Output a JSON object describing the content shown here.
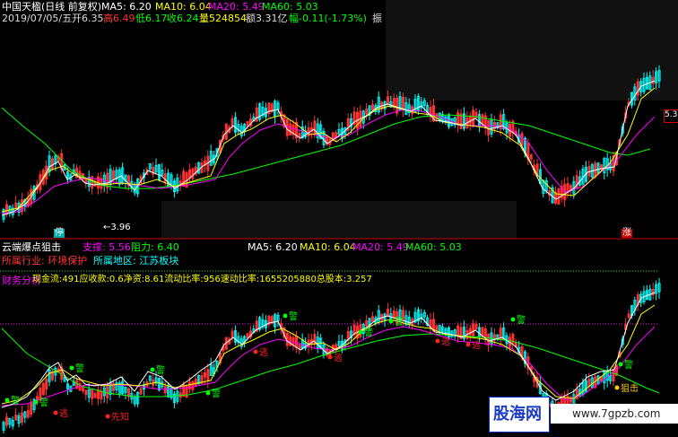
{
  "top": {
    "title": "中国天楹(日线 前复权)",
    "ma5": "MA5: 6.20",
    "ma10": "MA10: 6.04",
    "ma20": "MA20: 5.49",
    "ma60": "MA60: 5.03",
    "date": "2019/07/05/五",
    "open": "开6.35",
    "high": "高6.49",
    "low": "低6.17",
    "close": "收6.24",
    "volume": "量524854",
    "amount": "额3.31亿",
    "change": "幅-0.11(-1.73%)",
    "amplitude": "振",
    "low_marker": "←3.96",
    "stop_tag": "停",
    "rise_tag": "涨",
    "scale_label": "5.3"
  },
  "indicator": {
    "name": "云端爆点狙击",
    "support": "支撑: 5.56",
    "resistance": "阻力: 6.40",
    "ma5": "MA5: 6.20",
    "ma10": "MA10: 6.04",
    "ma20": "MA20: 5.49",
    "ma60": "MA60: 5.03",
    "industry": "所属行业: 环境保护",
    "region": "所属地区: 江苏板块",
    "finance": "财务分析",
    "finance_line": "现金流:491应收款:0.6净资:8.61流动比率:956速动比率:1655205880总股本:3.257",
    "signals": {
      "warn": "警",
      "stop": "逃",
      "forecast": "先知",
      "snipe": "狙击"
    }
  },
  "watermark": {
    "brand": "股海网",
    "url": "www.7gpzb.com"
  },
  "colors": {
    "ma5": "#ffffff",
    "ma10": "#ffff00",
    "ma20": "#ff00ff",
    "ma60": "#00ff00",
    "up": "#00ffff",
    "down": "#ff3030",
    "signal_green": "#00ff00",
    "signal_red": "#ff2020",
    "support_line": "#ff00ff",
    "resistance_line": "#00ff00"
  }
}
